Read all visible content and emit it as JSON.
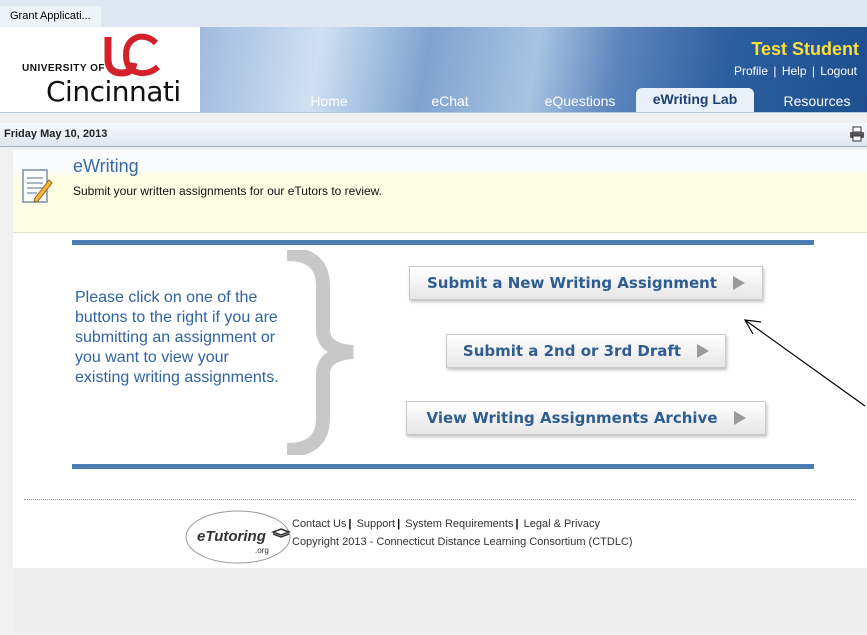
{
  "tab": {
    "title": "Grant Applicati..."
  },
  "header": {
    "logo_top": "UNIVERSITY OF",
    "logo_main": "Cincinnati",
    "user_name": "Test Student",
    "links": [
      "Profile",
      "Help",
      "Logout"
    ],
    "nav": [
      "Home",
      "eChat",
      "eQuestions",
      "eWriting Lab",
      "Resources"
    ],
    "active_nav": "eWriting Lab"
  },
  "datebar": {
    "date": "Friday May 10, 2013",
    "print_icon": "printer-icon"
  },
  "ewriting": {
    "title": "eWriting",
    "subtitle": "Submit your written assignments for our eTutors to review."
  },
  "main": {
    "instructions": "Please click on one of the buttons to the right if you are submitting an assignment or you want to view your existing writing assignments.",
    "buttons": [
      "Submit a New Writing Assignment",
      "Submit a 2nd or 3rd Draft",
      "View Writing Assignments Archive"
    ]
  },
  "footer": {
    "logo_text": "eTutoring",
    "logo_sub": ".org",
    "links": [
      "Contact Us",
      "Support",
      "System Requirements",
      "Legal & Privacy"
    ],
    "copyright": "Copyright 2013 - Connecticut Distance Learning Consortium (CTDLC)"
  },
  "colors": {
    "accent": "#4a7db2",
    "name_yellow": "#ffde3b",
    "button_text": "#2f5d92"
  }
}
